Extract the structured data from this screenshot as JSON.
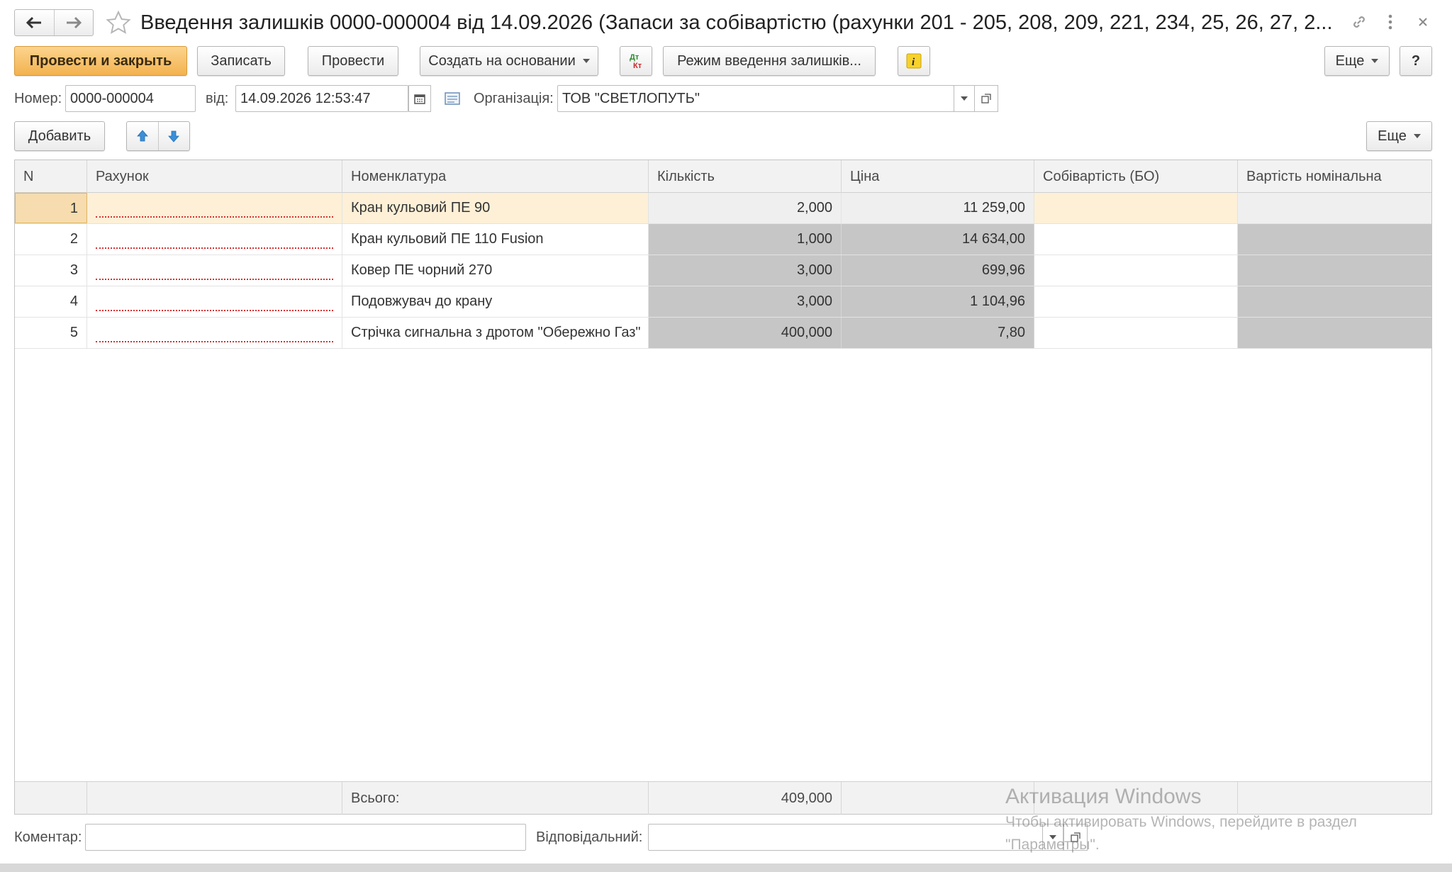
{
  "title": {
    "text": "Введення залишків 0000-000004 від 14.09.2026 (Запаси за собівартістю (рахунки 201 - 205, 208, 209, 221, 234, 25, 26, 27, 2..."
  },
  "toolbar": {
    "post_close": "Провести и закрыть",
    "write": "Записать",
    "post": "Провести",
    "create_based": "Создать на основании",
    "mode": "Режим введення залишків...",
    "more": "Еще",
    "help": "?"
  },
  "form": {
    "number_label": "Номер:",
    "number_value": "0000-000004",
    "date_label": "від:",
    "date_value": "14.09.2026 12:53:47",
    "org_label": "Організація:",
    "org_value": "ТОВ \"СВЕТЛОПУТЬ\""
  },
  "table_toolbar": {
    "add": "Добавить",
    "more": "Еще"
  },
  "table": {
    "columns": [
      "N",
      "Рахунок",
      "Номенклатура",
      "Кількість",
      "Ціна",
      "Собівартість (БО)",
      "Вартість номінальна"
    ],
    "rows": [
      {
        "n": "1",
        "account": "",
        "item": "Кран кульовий ПЕ 90",
        "qty": "2,000",
        "price": "11 259,00",
        "cost": "",
        "nominal": ""
      },
      {
        "n": "2",
        "account": "",
        "item": "Кран кульовий ПЕ 110 Fusion",
        "qty": "1,000",
        "price": "14 634,00",
        "cost": "",
        "nominal": ""
      },
      {
        "n": "3",
        "account": "",
        "item": "Ковер ПЕ чорний 270",
        "qty": "3,000",
        "price": "699,96",
        "cost": "",
        "nominal": ""
      },
      {
        "n": "4",
        "account": "",
        "item": "Подовжувач до крану",
        "qty": "3,000",
        "price": "1 104,96",
        "cost": "",
        "nominal": ""
      },
      {
        "n": "5",
        "account": "",
        "item": "Стрічка сигнальна з дротом \"Обережно Газ\"",
        "qty": "400,000",
        "price": "7,80",
        "cost": "",
        "nominal": ""
      }
    ],
    "footer_label": "Всього:",
    "footer_qty": "409,000"
  },
  "bottom": {
    "comment_label": "Коментар:",
    "comment_value": "",
    "responsible_label": "Відповідальний:",
    "responsible_value": ""
  },
  "watermark": {
    "line1": "Активация Windows",
    "line2": "Чтобы активировать Windows, перейдите в раздел",
    "line3": "\"Параметры\"."
  },
  "colors": {
    "primary_button": "#f3b24f",
    "selected_row": "#fdf0d7",
    "readonly_cell": "#c6c6c6",
    "error_underline": "#d83030"
  }
}
